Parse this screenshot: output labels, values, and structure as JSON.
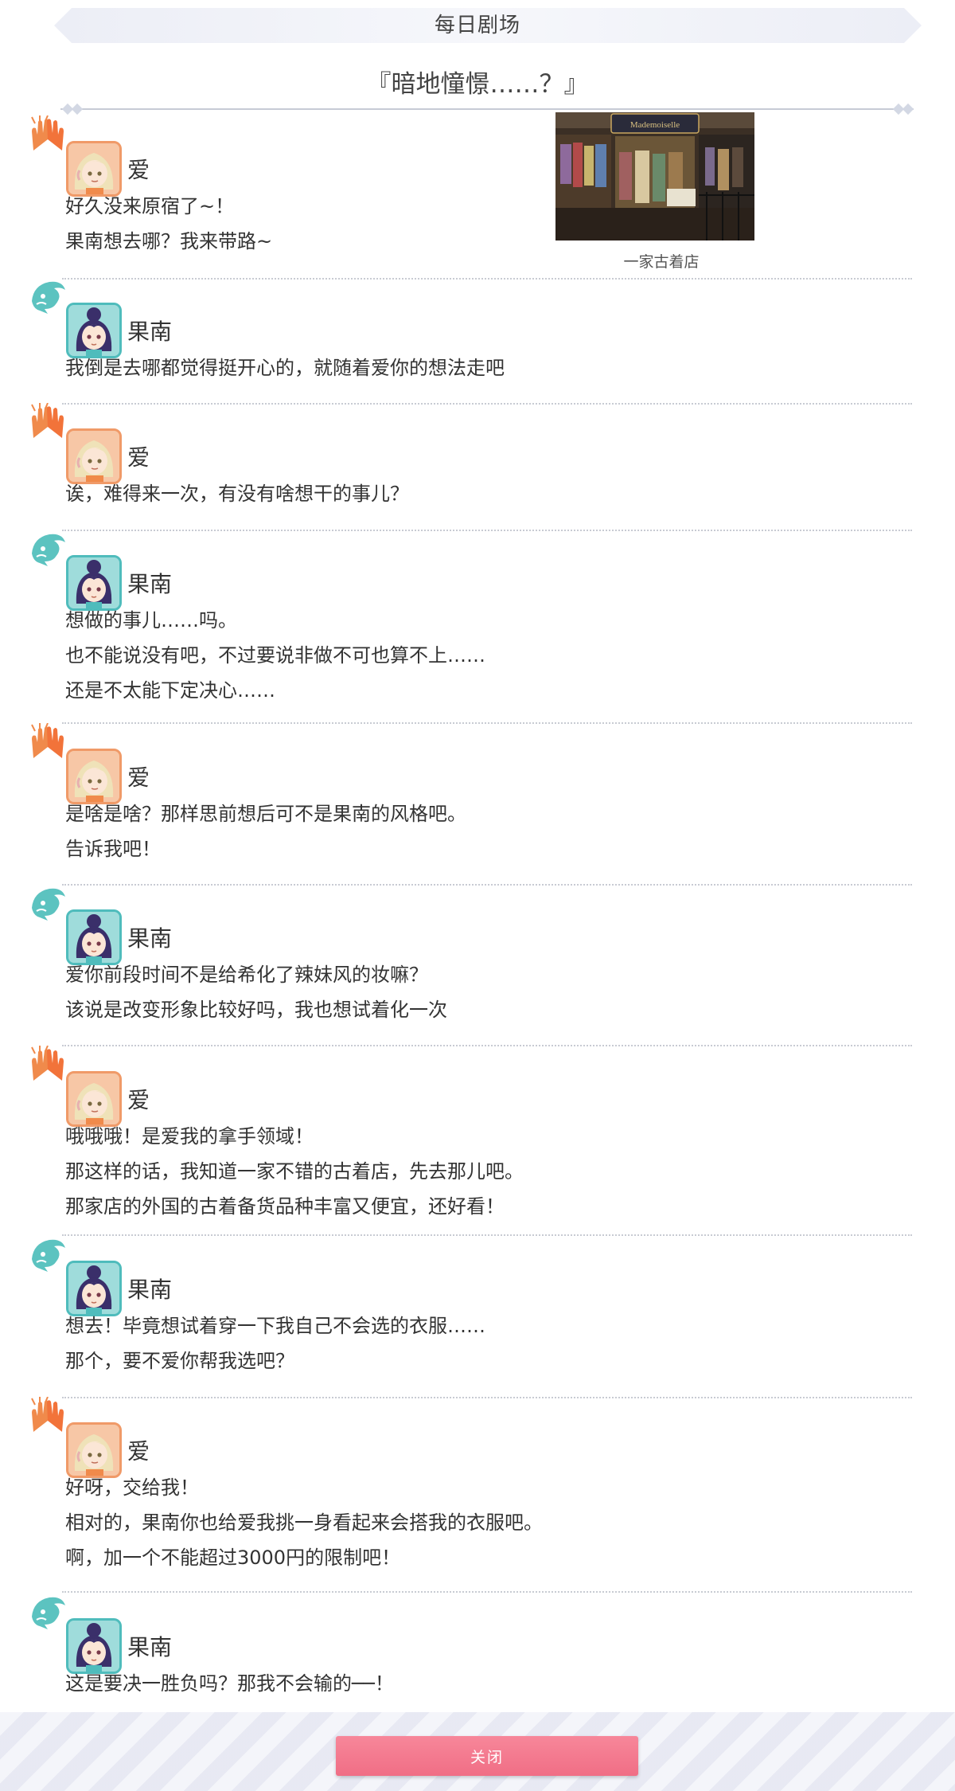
{
  "header": {
    "title": "每日剧场"
  },
  "story": {
    "title": "『暗地憧憬……？』"
  },
  "photo": {
    "caption": "一家古着店",
    "sign_text": "Mademoiselle"
  },
  "speakers": {
    "ai": "爱",
    "kanan": "果南"
  },
  "messages": [
    {
      "speaker": "爱",
      "character": "ai",
      "lines": [
        "好久没来原宿了~！",
        "果南想去哪？我来带路~"
      ]
    },
    {
      "speaker": "果南",
      "character": "kanan",
      "lines": [
        "我倒是去哪都觉得挺开心的，就随着爱你的想法走吧"
      ]
    },
    {
      "speaker": "爱",
      "character": "ai",
      "lines": [
        "诶，难得来一次，有没有啥想干的事儿？"
      ]
    },
    {
      "speaker": "果南",
      "character": "kanan",
      "lines": [
        "想做的事儿……吗。",
        "也不能说没有吧，不过要说非做不可也算不上……",
        "还是不太能下定决心……"
      ]
    },
    {
      "speaker": "爱",
      "character": "ai",
      "lines": [
        "是啥是啥？那样思前想后可不是果南的风格吧。",
        "告诉我吧！"
      ]
    },
    {
      "speaker": "果南",
      "character": "kanan",
      "lines": [
        "爱你前段时间不是给希化了辣妹风的妆嘛？",
        "该说是改变形象比较好吗，我也想试着化一次"
      ]
    },
    {
      "speaker": "爱",
      "character": "ai",
      "lines": [
        "哦哦哦！是爱我的拿手领域！",
        "那这样的话，我知道一家不错的古着店，先去那儿吧。",
        "那家店的外国的古着备货品种丰富又便宜，还好看！"
      ]
    },
    {
      "speaker": "果南",
      "character": "kanan",
      "lines": [
        "想去！毕竟想试着穿一下我自己不会选的衣服……",
        "那个，要不爱你帮我选吧？"
      ]
    },
    {
      "speaker": "爱",
      "character": "ai",
      "lines": [
        "好呀，交给我！",
        "相对的，果南你也给爱我挑一身看起来会搭我的衣服吧。",
        "啊，加一个不能超过3000円的限制吧！"
      ]
    },
    {
      "speaker": "果南",
      "character": "kanan",
      "lines": [
        "这是要决一胜负吗？那我不会输的──！"
      ]
    }
  ],
  "footer": {
    "close_label": "关闭"
  },
  "colors": {
    "ai_accent": "#f08a4b",
    "kanan_accent": "#4fbcbc",
    "close_button": "#f27b8f"
  },
  "icons": {
    "ai_emblem": "hands-emblem-icon",
    "kanan_emblem": "dolphin-emblem-icon"
  }
}
